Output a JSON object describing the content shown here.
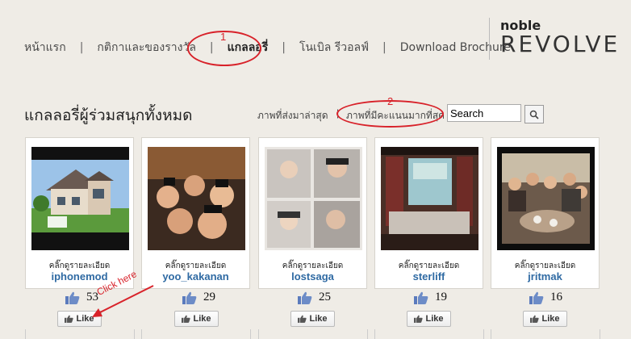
{
  "nav": {
    "items": [
      {
        "label": "หน้าแรก"
      },
      {
        "label": "กติกาและของรางวัล"
      },
      {
        "label": "แกลลอรี่"
      },
      {
        "label": "โนเบิล รีวอลฟ์"
      },
      {
        "label": "Download Brochure"
      }
    ],
    "separator": "|"
  },
  "logo": {
    "small": "noble",
    "big": "REVOLVE"
  },
  "gallery": {
    "title": "แกลลอรี่ผู้ร่วมสนุกทั้งหมด",
    "filter_latest": "ภาพที่ส่งมาล่าสุด",
    "filter_top": "ภาพที่มีคะแนนมากที่สุด",
    "filter_separator": "|"
  },
  "search": {
    "value": "Search"
  },
  "annotations": {
    "num1": "1",
    "num2": "2",
    "click_here": "Click here"
  },
  "cards": [
    {
      "detail_label": "คลิ๊กดูรายละเอียด",
      "username": "iphonemod",
      "votes": "53",
      "like_label": "Like"
    },
    {
      "detail_label": "คลิ๊กดูรายละเอียด",
      "username": "yoo_kakanan",
      "votes": "29",
      "like_label": "Like"
    },
    {
      "detail_label": "คลิ๊กดูรายละเอียด",
      "username": "lostsaga",
      "votes": "25",
      "like_label": "Like"
    },
    {
      "detail_label": "คลิ๊กดูรายละเอียด",
      "username": "sterliff",
      "votes": "19",
      "like_label": "Like"
    },
    {
      "detail_label": "คลิ๊กดูรายละเอียด",
      "username": "jritmak",
      "votes": "16",
      "like_label": "Like"
    }
  ],
  "colors": {
    "annotation": "#d8222a",
    "username": "#2f6aa3",
    "background": "#efece6"
  }
}
